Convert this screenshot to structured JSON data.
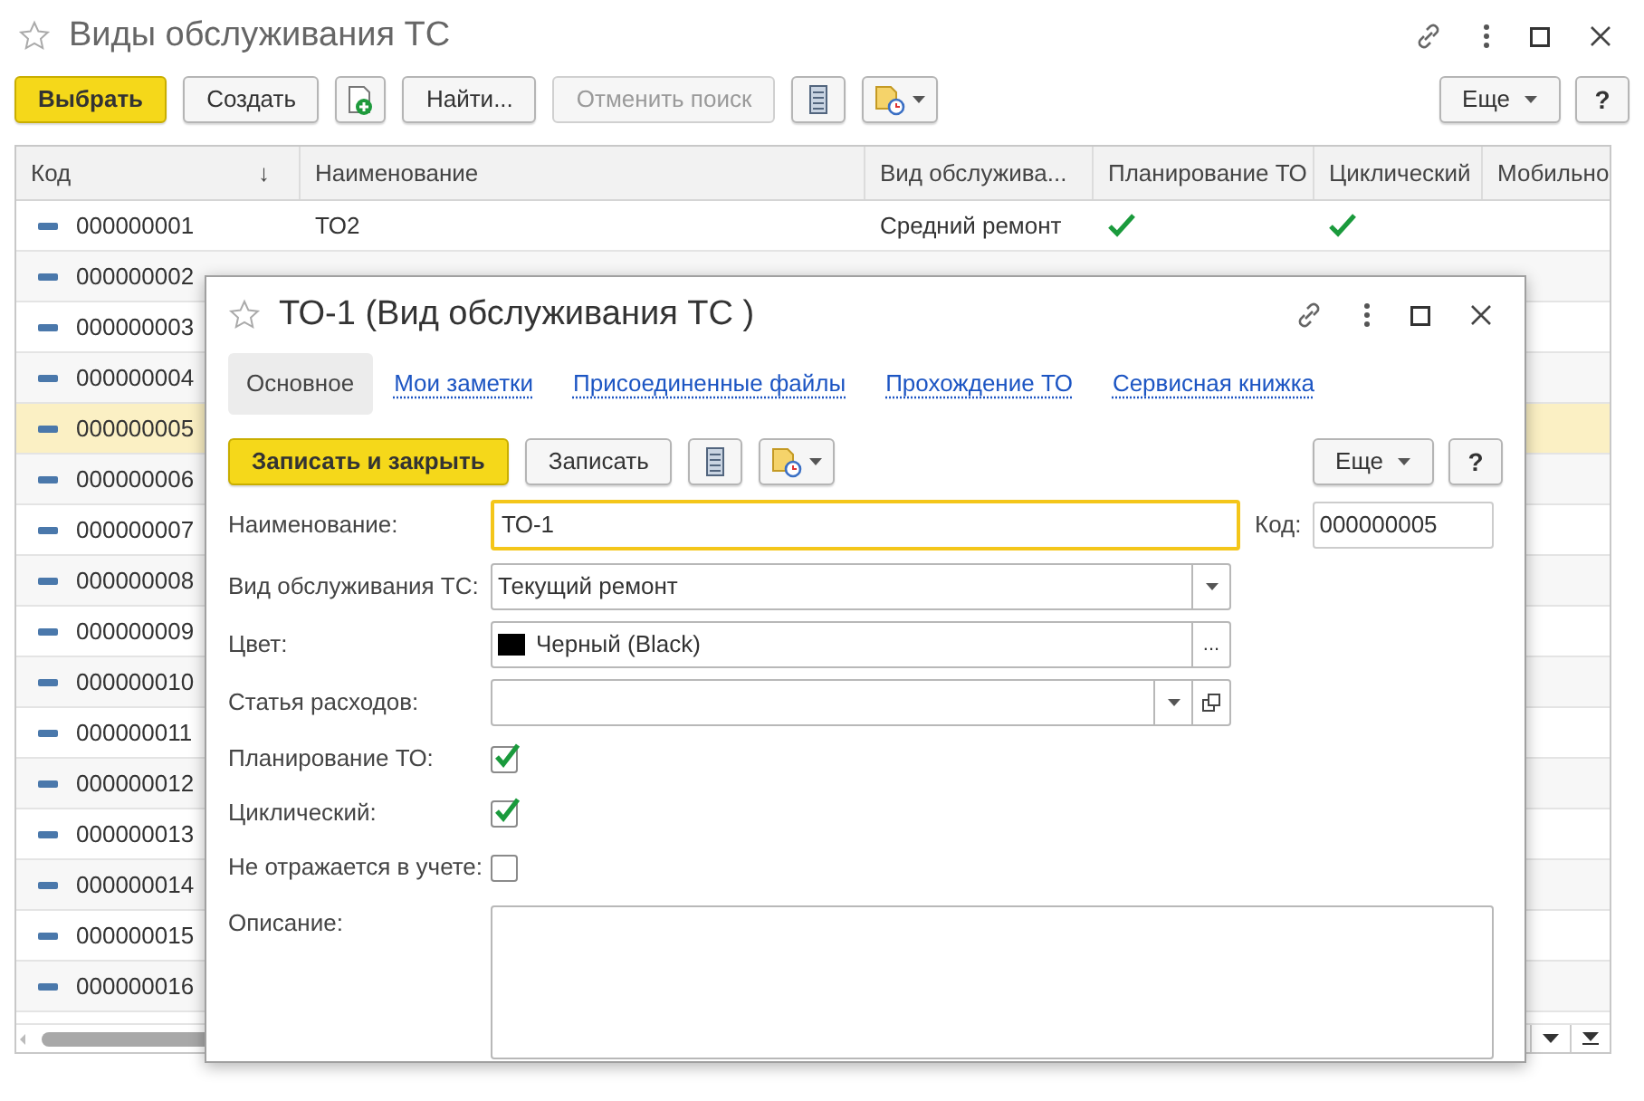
{
  "window": {
    "title": "Виды обслуживания ТС"
  },
  "toolbar": {
    "buttons": [
      {
        "kind": "primary",
        "label": "Выбрать"
      },
      {
        "kind": "text",
        "label": "Создать"
      },
      {
        "kind": "add"
      },
      {
        "kind": "text",
        "label": "Найти..."
      },
      {
        "kind": "disabled",
        "label": "Отменить поиск"
      },
      {
        "kind": "list"
      },
      {
        "kind": "report"
      }
    ],
    "more": "Еще",
    "help": "?"
  },
  "table": {
    "columns": [
      {
        "label": "Код",
        "sort_mark": "↓"
      },
      {
        "label": "Наименование"
      },
      {
        "label": "Вид обслужива..."
      },
      {
        "label": "Планирование ТО"
      },
      {
        "label": "Циклический"
      },
      {
        "label": "Мобильно"
      }
    ],
    "rows": [
      {
        "code": "000000001",
        "name": "ТО2",
        "type": "Средний ремонт",
        "planning": true,
        "cyclic": true,
        "selected": false
      },
      {
        "code": "000000002",
        "selected": false
      },
      {
        "code": "000000003",
        "selected": false
      },
      {
        "code": "000000004",
        "selected": false
      },
      {
        "code": "000000005",
        "selected": true
      },
      {
        "code": "000000006",
        "selected": false
      },
      {
        "code": "000000007",
        "selected": false
      },
      {
        "code": "000000008",
        "selected": false
      },
      {
        "code": "000000009",
        "selected": false
      },
      {
        "code": "000000010",
        "selected": false
      },
      {
        "code": "000000011",
        "selected": false
      },
      {
        "code": "000000012",
        "selected": false
      },
      {
        "code": "000000013",
        "selected": false
      },
      {
        "code": "000000014",
        "selected": false
      },
      {
        "code": "000000015",
        "selected": false
      },
      {
        "code": "000000016",
        "selected": false
      }
    ]
  },
  "dialog": {
    "title": "ТО-1 (Вид обслуживания ТС )",
    "tabs": [
      {
        "label": "Основное",
        "selected": true
      },
      {
        "label": "Мои заметки",
        "selected": false
      },
      {
        "label": "Присоединенные файлы",
        "selected": false
      },
      {
        "label": "Прохождение ТО",
        "selected": false
      },
      {
        "label": "Сервисная книжка",
        "selected": false
      }
    ],
    "toolbar": {
      "buttons": [
        {
          "kind": "primary",
          "label": "Записать и закрыть"
        },
        {
          "kind": "text",
          "label": "Записать"
        },
        {
          "kind": "list"
        },
        {
          "kind": "report"
        }
      ],
      "more": "Еще",
      "help": "?"
    },
    "fields": [
      {
        "kind": "text",
        "label": "Наименование:",
        "value": "ТО-1",
        "focused": true,
        "code_label": "Код:",
        "code_value": "000000005"
      },
      {
        "kind": "select",
        "label": "Вид обслуживания ТС:",
        "value": "Текущий ремонт"
      },
      {
        "kind": "color",
        "label": "Цвет:",
        "value": "Черный (Black)",
        "color": "#000000",
        "button": "..."
      },
      {
        "kind": "select-open",
        "label": "Статья расходов:"
      },
      {
        "kind": "checkbox",
        "label": "Планирование ТО:",
        "checked": true
      },
      {
        "kind": "checkbox",
        "label": "Циклический:",
        "checked": true
      },
      {
        "kind": "checkbox",
        "label": "Не отражается в учете:",
        "checked": false
      },
      {
        "kind": "textarea",
        "label": "Описание:"
      }
    ]
  }
}
